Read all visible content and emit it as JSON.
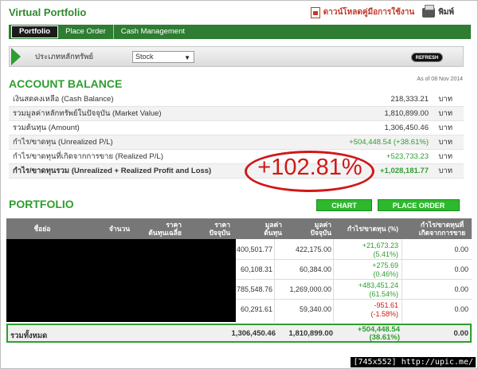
{
  "app_title": "Virtual Portfolio",
  "top_actions": {
    "download_manual": "ดาวน์โหลดคู่มือการใช้งาน",
    "print": "พิมพ์"
  },
  "tabs": [
    {
      "label": "Portfolio",
      "active": true
    },
    {
      "label": "Place Order",
      "active": false
    },
    {
      "label": "Cash Management",
      "active": false
    }
  ],
  "selector": {
    "label": "ประเภทหลักทรัพย์",
    "value": "Stock",
    "refresh_label": "REFRESH"
  },
  "account_balance": {
    "title": "ACCOUNT BALANCE",
    "as_of": "As of 08 Nov 2014",
    "unit": "บาท",
    "rows": [
      {
        "label": "เงินสดคงเหลือ (Cash Balance)",
        "value": "218,333.21"
      },
      {
        "label": "รวมมูลค่าหลักทรัพย์ในปัจจุบัน (Market Value)",
        "value": "1,810,899.00"
      },
      {
        "label": "รวมต้นทุน (Amount)",
        "value": "1,306,450.46"
      },
      {
        "label": "กำไร/ขาดทุน (Unrealized P/L)",
        "value": "+504,448.54 (+38.61%)"
      },
      {
        "label": "กำไร/ขาดทุนที่เกิดจากการขาย (Realized P/L)",
        "value": "+523,733.23"
      },
      {
        "label": "กำไร/ขาดทุนรวม (Unrealized + Realized Profit and Loss)",
        "value": "+1,028,181.77"
      }
    ]
  },
  "annotation": "+102.81%",
  "portfolio": {
    "title": "PORTFOLIO",
    "chart_button": "CHART",
    "place_order_button": "PLACE ORDER",
    "headers": {
      "symbol": "ชื่อย่อ",
      "volume": "จำนวน",
      "avg_cost_1": "ราคา",
      "avg_cost_2": "ต้นทุนเฉลี่ย",
      "price_1": "ราคา",
      "price_2": "ปัจจุบัน",
      "cost_value_1": "มูลค่า",
      "cost_value_2": "ต้นทุน",
      "market_value_1": "มูลค่า",
      "market_value_2": "ปัจจุบัน",
      "unrealized": "กำไร/ขาดทุน (%)",
      "realized_1": "กำไร/ขาดทุนที่",
      "realized_2": "เกิดจากการขาย"
    },
    "rows": [
      {
        "cost_value": "400,501.77",
        "market_value": "422,175.00",
        "pl": "+21,673.23",
        "pl_pct": "(5.41%)",
        "realized": "0.00"
      },
      {
        "cost_value": "60,108.31",
        "market_value": "60,384.00",
        "pl": "+275.69",
        "pl_pct": "(0.46%)",
        "realized": "0.00"
      },
      {
        "cost_value": "785,548.76",
        "market_value": "1,269,000.00",
        "pl": "+483,451.24",
        "pl_pct": "(61.54%)",
        "realized": "0.00"
      },
      {
        "cost_value": "60,291.61",
        "market_value": "59,340.00",
        "pl": "-951.61",
        "pl_pct": "(-1.58%)",
        "realized": "0.00"
      }
    ],
    "total": {
      "label": "รวมทั้งหมด",
      "cost_value": "1,306,450.46",
      "market_value": "1,810,899.00",
      "pl": "+504,448.54",
      "pl_pct": "(38.61%)",
      "realized": "0.00"
    }
  },
  "watermark": "[745x552] http://upic.me/"
}
